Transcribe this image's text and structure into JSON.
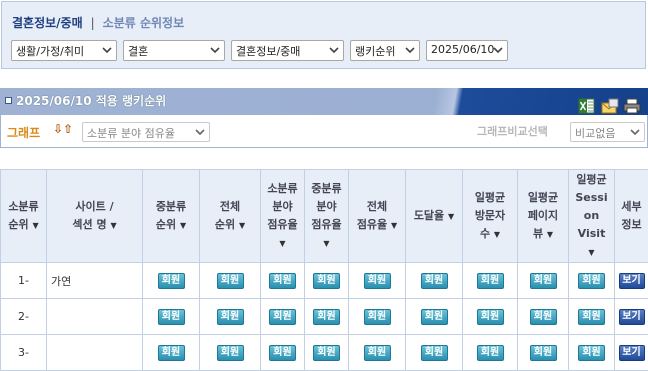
{
  "header": {
    "title": "결혼정보/중매",
    "separator": "|",
    "subtitle": "소분류 순위정보"
  },
  "filters": [
    {
      "value": "생활/가정/취미"
    },
    {
      "value": "결혼"
    },
    {
      "value": "결혼정보/중매"
    },
    {
      "value": "랭키순위"
    },
    {
      "value": "2025/06/10"
    }
  ],
  "ranking": {
    "title": "2025/06/10 적용 랭키순위",
    "graph_label": "그래프",
    "sort_icons": "⇩⇧",
    "graph_select": "소분류 분야 점유율",
    "compare_label": "그래프비교선택",
    "compare_select": "비교없음"
  },
  "table": {
    "columns": [
      {
        "label": "소분류 순위",
        "sortable": true
      },
      {
        "label": "사이트 / 섹션 명",
        "sortable": true
      },
      {
        "label": "중분류 순위",
        "sortable": true
      },
      {
        "label": "전체 순위",
        "sortable": true
      },
      {
        "label": "소분류 분야 점유율",
        "sortable": true
      },
      {
        "label": "중분류 분야 점유율",
        "sortable": true
      },
      {
        "label": "전체 점유율",
        "sortable": true
      },
      {
        "label": "도달율",
        "sortable": true
      },
      {
        "label": "일평균 방문자 수",
        "sortable": true
      },
      {
        "label": "일평균 페이지 뷰",
        "sortable": true
      },
      {
        "label": "일평균 Session Visit",
        "sortable": true
      },
      {
        "label": "세부 정보",
        "sortable": false
      }
    ],
    "member_label": "회원",
    "view_label": "보기",
    "rows": [
      {
        "rank": "1-",
        "site": "가연"
      },
      {
        "rank": "2-",
        "site": ""
      },
      {
        "rank": "3-",
        "site": ""
      }
    ]
  },
  "colors": {
    "header_blue": "#1d4c9b",
    "member_teal": "#2a8fb0",
    "graph_orange": "#d88a1a"
  }
}
